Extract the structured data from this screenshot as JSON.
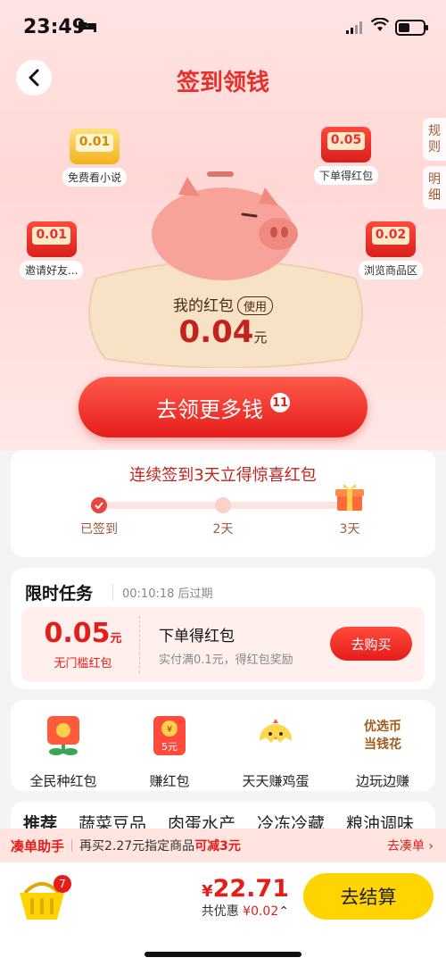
{
  "status_bar": {
    "time": "23:49"
  },
  "header": {
    "title": "签到领钱"
  },
  "side_tabs": [
    "规则",
    "明细"
  ],
  "bubbles": [
    {
      "amount": "0.01",
      "label": "免费看小说",
      "style": "gold"
    },
    {
      "amount": "0.05",
      "label": "下单得红包",
      "style": "red"
    },
    {
      "amount": "0.01",
      "label": "邀请好友...",
      "style": "red"
    },
    {
      "amount": "0.02",
      "label": "浏览商品区",
      "style": "red"
    }
  ],
  "wallet": {
    "label": "我的红包",
    "use": "使用",
    "amount": "0.04",
    "unit": "元"
  },
  "earn_button": {
    "label": "去领更多钱",
    "badge": "11"
  },
  "streak": {
    "title": "连续签到3天立得惊喜红包",
    "steps": [
      {
        "label": "已签到",
        "done": true
      },
      {
        "label": "2天",
        "done": false
      },
      {
        "label": "3天",
        "done": false
      }
    ]
  },
  "tasks": {
    "title": "限时任务",
    "timer": "00:10:18 后过期",
    "coupon": {
      "amount": "0.05",
      "unit": "元",
      "condition": "无门槛红包",
      "name": "下单得红包",
      "desc": "实付满0.1元，得红包奖励",
      "button": "去购买"
    }
  },
  "grid": [
    {
      "label": "全民种红包",
      "icon": "red-flower-icon"
    },
    {
      "label": "赚红包",
      "icon": "red-envelope-icon",
      "badge": "5元"
    },
    {
      "label": "天天赚鸡蛋",
      "icon": "chick-icon"
    },
    {
      "label": "边玩边赚",
      "icon": "text-logo",
      "logo_lines": [
        "优选币",
        "当钱花"
      ]
    }
  ],
  "tabs": [
    "推荐",
    "蔬菜豆品",
    "肉蛋水产",
    "冷冻冷藏",
    "粮油调味"
  ],
  "helper": {
    "name": "凑单助手",
    "text_prefix": "再买2.27元指定商品",
    "text_highlight": "可减3元",
    "link": "去凑单 ›"
  },
  "checkout": {
    "cart_count": "7",
    "price_symbol": "¥",
    "price": "22.71",
    "saving_label": "共优惠",
    "saving_value": "¥0.02",
    "button": "去结算"
  },
  "colors": {
    "accent": "#e41d1a",
    "checkout": "#ffd400"
  }
}
